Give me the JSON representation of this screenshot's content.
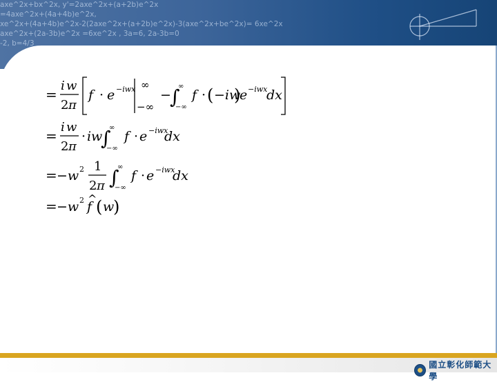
{
  "header": {
    "background_lines": [
      "axe^2x+bx^2x, y'=2axe^2x+(a+2b)e^2x",
      "=4axe^2x+(4a+4b)e^2x,",
      "xe^2x+(4a+4b)e^2x-2(2axe^2x+(a+2b)e^2x)-3(axe^2x+be^2x)= 6xe^2x",
      "axe^2x+(2a-3b)e^2x =6xe^2x , 3a=6, 2a-3b=0",
      "-2, b=4/3"
    ]
  },
  "math": {
    "eq": "=",
    "i": "i",
    "w": "w",
    "two": "2",
    "pi": "π",
    "one": "1",
    "f": "f",
    "e": "e",
    "dot": "·",
    "exp": "−iwx",
    "infinity": "∞",
    "neg_infinity": "−∞",
    "dx": "dx",
    "minus": "−",
    "int": "∫",
    "lparen": "(",
    "rparen": ")",
    "neg_iw": "−iw",
    "neg_w": "−w",
    "sq": "2",
    "hat": "^"
  },
  "footer": {
    "logo_text": "國立彰化師範大學"
  },
  "colors": {
    "banner": "#3d659a",
    "gold": "#d9a520",
    "frame": "#8aa8cc"
  }
}
